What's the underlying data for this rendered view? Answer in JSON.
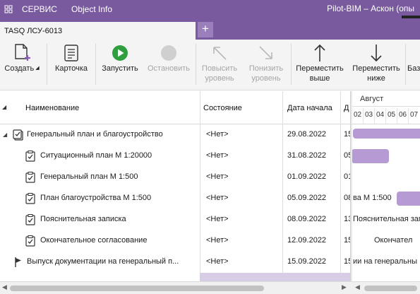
{
  "titlebar": {
    "menu": [
      "СЕРВИС",
      "Object Info"
    ],
    "app_title": "Pilot-BIM – Аскон (опы"
  },
  "tabs": {
    "active_label": "TASQ ЛСУ-6013",
    "add_label": "+"
  },
  "toolbar": {
    "create": "Создать",
    "card": "Карточка",
    "start": "Запустить",
    "stop": "Остановить",
    "raise": [
      "Повысить",
      "уровень"
    ],
    "lower": [
      "Понизить",
      "уровень"
    ],
    "move_up": [
      "Переместить",
      "выше"
    ],
    "move_down": [
      "Переместить",
      "ниже"
    ],
    "base": "Баз"
  },
  "colors": {
    "accent": "#7a5a9e",
    "bar": "#b59ad4",
    "start_green": "#2e9e3e"
  },
  "columns": {
    "name": "Наименование",
    "state": "Состояние",
    "start_date": "Дата начала",
    "end_date_cut": "Д"
  },
  "gantt": {
    "month": "Август",
    "days": [
      "02",
      "03",
      "04",
      "05",
      "06",
      "07"
    ]
  },
  "rows": [
    {
      "name": "Генеральный план и благоустройство",
      "state": "<Нет>",
      "date": "29.08.2022",
      "date2": "15",
      "icon": "task-group-icon",
      "level": 0
    },
    {
      "name": "Ситуационный план М 1:20000",
      "state": "<Нет>",
      "date": "31.08.2022",
      "date2": "05",
      "icon": "task-icon",
      "level": 1
    },
    {
      "name": "Генеральный план М 1:500",
      "state": "<Нет>",
      "date": "01.09.2022",
      "date2": "01",
      "icon": "task-icon",
      "level": 1
    },
    {
      "name": "План благоустройства М 1:500",
      "state": "<Нет>",
      "date": "05.09.2022",
      "date2": "08",
      "icon": "task-icon",
      "level": 1
    },
    {
      "name": "Пояснительная записка",
      "state": "<Нет>",
      "date": "08.09.2022",
      "date2": "13",
      "icon": "task-icon",
      "level": 1
    },
    {
      "name": "Окончательное согласование",
      "state": "<Нет>",
      "date": "12.09.2022",
      "date2": "15",
      "icon": "task-icon",
      "level": 1
    },
    {
      "name": "Выпуск документации на генеральный п...",
      "state": "<Нет>",
      "date": "15.09.2022",
      "date2": "15",
      "icon": "flag-icon",
      "level": 0
    }
  ],
  "gantt_labels": {
    "row3": "ва М 1:500",
    "row4": "Пояснительная запис",
    "row5": "Окончател",
    "row6": "ии на генеральны"
  }
}
